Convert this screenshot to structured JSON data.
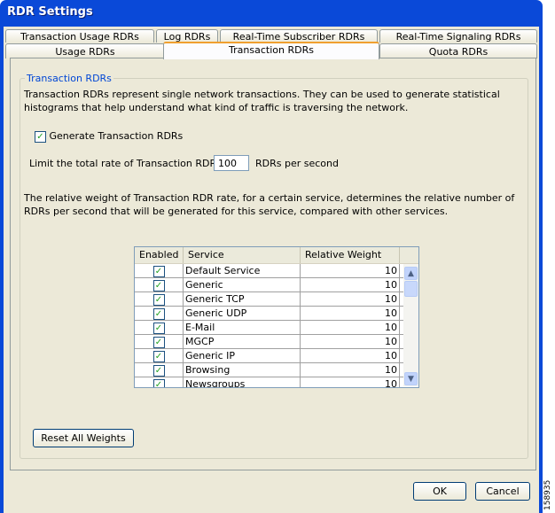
{
  "window": {
    "title": "RDR Settings"
  },
  "tabs_row1": [
    "Transaction Usage RDRs",
    "Log RDRs",
    "Real-Time Subscriber RDRs",
    "Real-Time Signaling RDRs"
  ],
  "tabs_row2": [
    "Usage RDRs",
    "Transaction RDRs",
    "Quota RDRs"
  ],
  "group": {
    "label": "Transaction RDRs",
    "description": "Transaction RDRs represent single network transactions. They can be used to generate statistical histograms that help understand what kind of traffic is traversing the network.",
    "generate_label": "Generate Transaction RDRs",
    "generate_checked": true,
    "limit_prefix": "Limit the total rate of Transaction RDRs to",
    "limit_value": "100",
    "limit_suffix": "RDRs per second",
    "weight_desc": "The relative weight of Transaction RDR rate, for a certain service, determines the relative number of RDRs per second that will be generated for this service, compared with other services."
  },
  "table": {
    "headers": [
      "Enabled",
      "Service",
      "Relative Weight"
    ],
    "rows": [
      {
        "service": "Default Service",
        "weight": "10"
      },
      {
        "service": "Generic",
        "weight": "10"
      },
      {
        "service": "Generic TCP",
        "weight": "10"
      },
      {
        "service": "Generic UDP",
        "weight": "10"
      },
      {
        "service": "E-Mail",
        "weight": "10"
      },
      {
        "service": "MGCP",
        "weight": "10"
      },
      {
        "service": "Generic IP",
        "weight": "10"
      },
      {
        "service": "Browsing",
        "weight": "10"
      },
      {
        "service": "Newsgroups",
        "weight": "10"
      }
    ]
  },
  "buttons": {
    "reset": "Reset All Weights",
    "ok": "OK",
    "cancel": "Cancel"
  },
  "figure_id": "158935"
}
